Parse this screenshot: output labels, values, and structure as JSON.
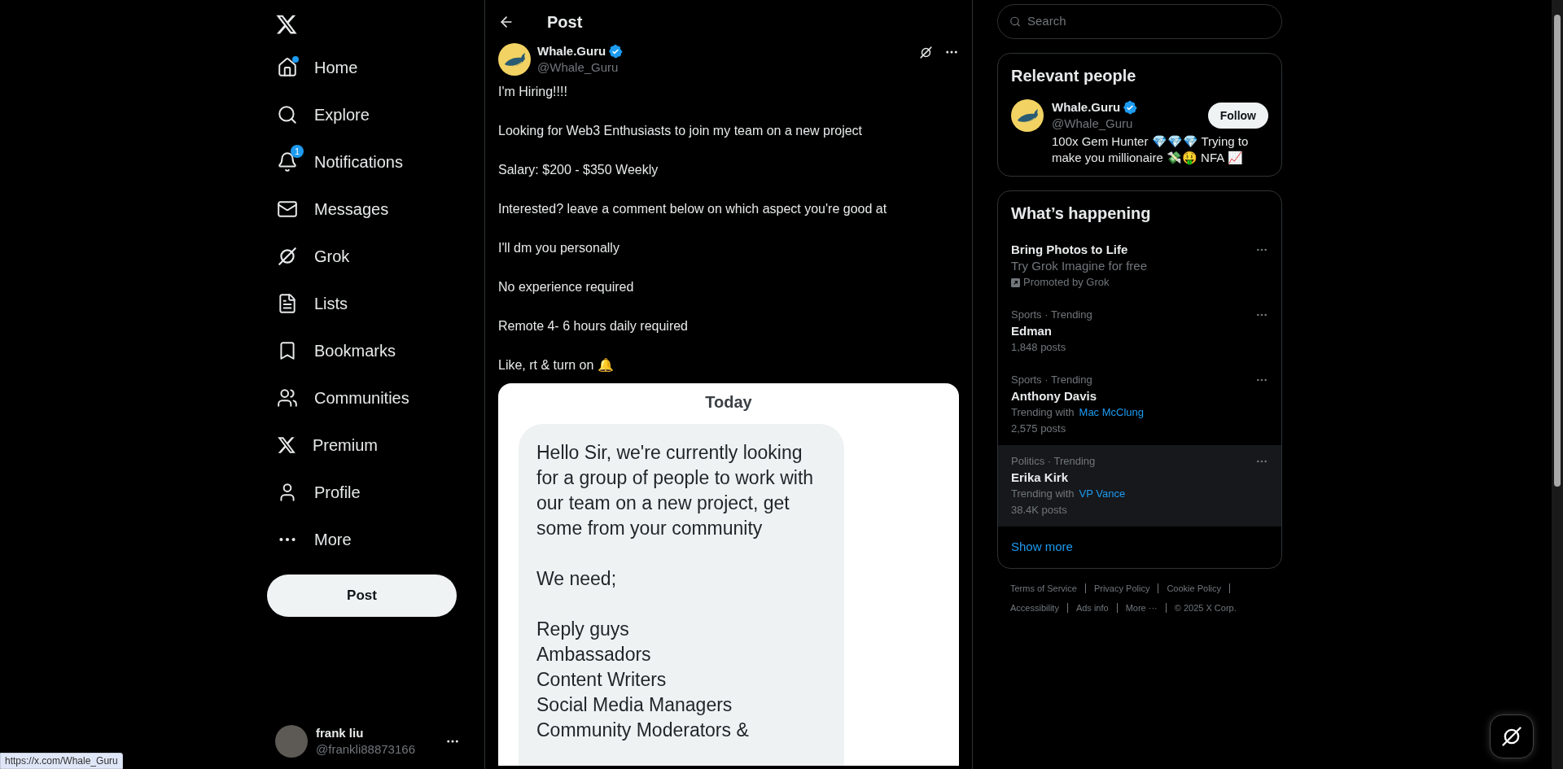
{
  "nav": {
    "items": [
      {
        "label": "Home",
        "dot": true
      },
      {
        "label": "Explore",
        "dot": false
      },
      {
        "label": "Notifications",
        "dot": false,
        "badge": "1"
      },
      {
        "label": "Messages",
        "dot": false
      },
      {
        "label": "Grok",
        "dot": false
      },
      {
        "label": "Lists",
        "dot": false
      },
      {
        "label": "Bookmarks",
        "dot": false
      },
      {
        "label": "Communities",
        "dot": false
      },
      {
        "label": "Premium",
        "dot": false
      },
      {
        "label": "Profile",
        "dot": false
      },
      {
        "label": "More",
        "dot": false
      }
    ],
    "post_button": "Post",
    "account": {
      "name": "frank liu",
      "handle": "@frankli88873166"
    }
  },
  "main": {
    "header": "Post",
    "post": {
      "author": "Whale.Guru",
      "verified": true,
      "handle": "@Whale_Guru",
      "paragraphs": [
        "I'm Hiring!!!!",
        "Looking for Web3 Enthusiasts to join my team on a new project",
        "Salary: $200 - $350 Weekly",
        "Interested? leave a comment below on which aspect you're good at",
        "I'll dm you personally",
        "No experience required",
        "Remote 4- 6 hours daily required",
        "Like, rt & turn on 🔔"
      ],
      "image": {
        "date": "Today",
        "message": [
          "Hello Sir, we're currently looking for a group of people to work with our team on a new project, get some from your community",
          "We need;",
          "Reply guys\nAmbassadors\nContent Writers\nSocial Media Managers\nCommunity Moderators &"
        ]
      }
    }
  },
  "search": {
    "placeholder": "Search"
  },
  "relevant_people": {
    "title": "Relevant people",
    "people": [
      {
        "name": "Whale.Guru",
        "verified": true,
        "handle": "@Whale_Guru",
        "bio": "100x Gem Hunter 💎💎💎 Trying to make you millionaire 💸🤑 NFA 📈",
        "button": "Follow"
      }
    ]
  },
  "trends": {
    "title": "What’s happening",
    "items": [
      {
        "kind": "promo",
        "title": "Bring Photos to Life",
        "subtitle": "Try Grok Imagine for free",
        "promoted": "Promoted by Grok",
        "highlighted": false
      },
      {
        "kind": "trend",
        "context": "Sports · Trending",
        "title": "Edman",
        "posts": "1,848 posts",
        "highlighted": false
      },
      {
        "kind": "trend",
        "context": "Sports · Trending",
        "title": "Anthony Davis",
        "with_label": "Trending with",
        "with": "Mac McClung",
        "posts": "2,575 posts",
        "highlighted": false
      },
      {
        "kind": "trend",
        "context": "Politics · Trending",
        "title": "Erika Kirk",
        "with_label": "Trending with",
        "with": "VP Vance",
        "posts": "38.4K posts",
        "highlighted": true
      }
    ],
    "show_more": "Show more"
  },
  "footer": {
    "links": [
      "Terms of Service",
      "Privacy Policy",
      "Cookie Policy",
      "Accessibility",
      "Ads info",
      "More ···"
    ],
    "copyright": "© 2025 X Corp."
  },
  "status_url": "https://x.com/Whale_Guru"
}
